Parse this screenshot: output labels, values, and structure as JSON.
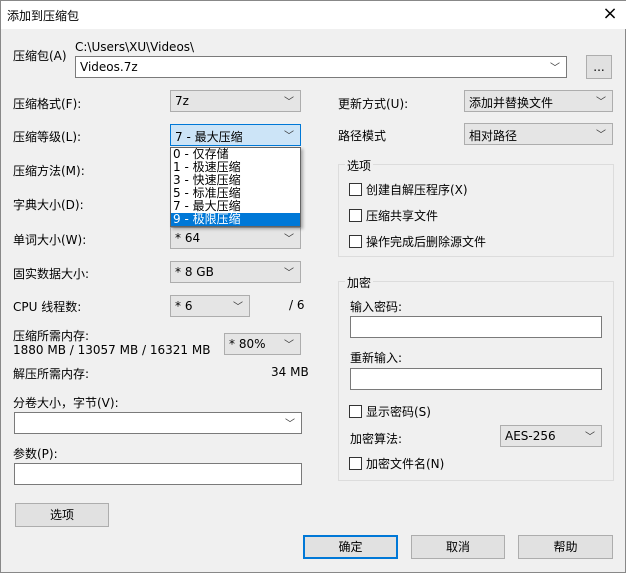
{
  "window": {
    "title": "添加到压缩包",
    "close_icon": "×"
  },
  "archive": {
    "label": "压缩包(A)",
    "path": "C:\\Users\\XU\\Videos\\",
    "value": "Videos.7z",
    "browse_label": "..."
  },
  "left": {
    "format": {
      "label": "压缩格式(F):",
      "value": "7z"
    },
    "level": {
      "label": "压缩等级(L):",
      "value": "7 - 最大压缩",
      "options": [
        "0 - 仅存储",
        "1 - 极速压缩",
        "3 - 快速压缩",
        "5 - 标准压缩",
        "7 - 最大压缩",
        "9 - 极限压缩"
      ]
    },
    "method": {
      "label": "压缩方法(M):"
    },
    "dict": {
      "label": "字典大小(D):"
    },
    "word": {
      "label": "单词大小(W):",
      "value": "* 64"
    },
    "solid": {
      "label": "固实数据大小:",
      "value": "* 8 GB"
    },
    "cpu": {
      "label": "CPU 线程数:",
      "value": "* 6",
      "total": "/ 6"
    },
    "mem": {
      "label": "压缩所需内存:",
      "detail": "1880 MB / 13057 MB / 16321 MB",
      "value": "* 80%"
    },
    "decomp": {
      "label": "解压所需内存:",
      "value": "34 MB"
    },
    "volume": {
      "label": "分卷大小，字节(V):",
      "value": ""
    },
    "params": {
      "label": "参数(P):",
      "value": ""
    },
    "options_button": "选项"
  },
  "right": {
    "update": {
      "label": "更新方式(U):",
      "value": "添加并替换文件"
    },
    "path": {
      "label": "路径模式",
      "value": "相对路径"
    },
    "options": {
      "title": "选项",
      "items": [
        "创建自解压程序(X)",
        "压缩共享文件",
        "操作完成后删除源文件"
      ]
    },
    "encrypt": {
      "title": "加密",
      "pw_label": "输入密码:",
      "pw2_label": "重新输入:",
      "show_pw": "显示密码(S)",
      "algo_label": "加密算法:",
      "algo_value": "AES-256",
      "encrypt_names": "加密文件名(N)"
    }
  },
  "buttons": {
    "ok": "确定",
    "cancel": "取消",
    "help": "帮助"
  }
}
